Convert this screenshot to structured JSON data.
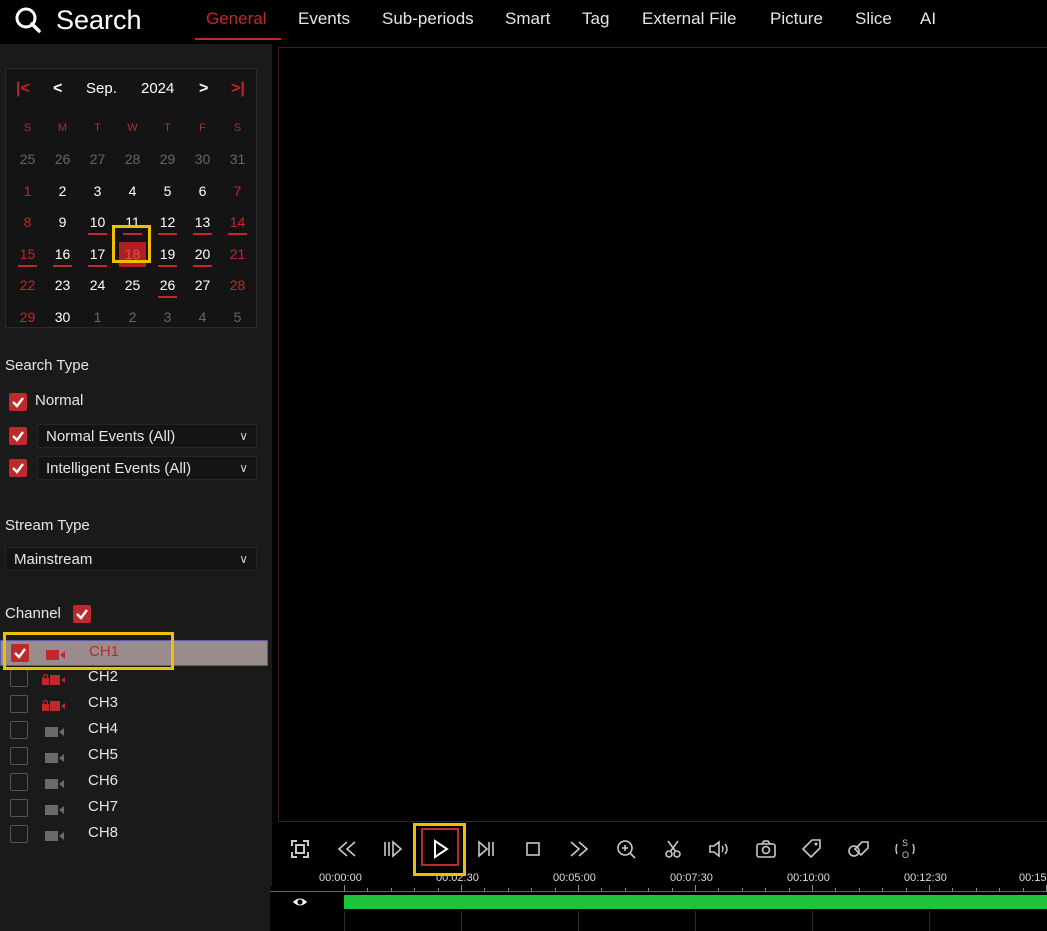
{
  "header": {
    "title": "Search",
    "tabs": [
      {
        "label": "General",
        "active": true
      },
      {
        "label": "Events"
      },
      {
        "label": "Sub-periods"
      },
      {
        "label": "Smart"
      },
      {
        "label": "Tag"
      },
      {
        "label": "External File"
      },
      {
        "label": "Picture"
      },
      {
        "label": "Slice"
      },
      {
        "label": "AI"
      }
    ]
  },
  "calendar": {
    "month": "Sep.",
    "year": "2024",
    "weekdays": [
      "S",
      "M",
      "T",
      "W",
      "T",
      "F",
      "S"
    ],
    "weeks": [
      [
        "25",
        "26",
        "27",
        "28",
        "29",
        "30",
        "31"
      ],
      [
        "1",
        "2",
        "3",
        "4",
        "5",
        "6",
        "7"
      ],
      [
        "8",
        "9",
        "10",
        "11",
        "12",
        "13",
        "14"
      ],
      [
        "15",
        "16",
        "17",
        "18",
        "19",
        "20",
        "21"
      ],
      [
        "22",
        "23",
        "24",
        "25",
        "26",
        "27",
        "28"
      ],
      [
        "29",
        "30",
        "1",
        "2",
        "3",
        "4",
        "5"
      ]
    ],
    "selected_day": "18",
    "days_with_recordings": [
      "10",
      "11",
      "12",
      "13",
      "14",
      "15",
      "16",
      "17",
      "19",
      "20",
      "26"
    ]
  },
  "search_type": {
    "label": "Search Type",
    "normal_label": "Normal",
    "normal_events": "Normal Events (All)",
    "intelligent_events": "Intelligent Events (All)"
  },
  "stream_type": {
    "label": "Stream Type",
    "value": "Mainstream"
  },
  "channel": {
    "label": "Channel",
    "items": [
      {
        "name": "CH1",
        "checked": true,
        "selected": true,
        "cam": "red"
      },
      {
        "name": "CH2",
        "checked": false,
        "cam": "red-lock"
      },
      {
        "name": "CH3",
        "checked": false,
        "cam": "red-lock"
      },
      {
        "name": "CH4",
        "checked": false,
        "cam": "gray"
      },
      {
        "name": "CH5",
        "checked": false,
        "cam": "gray"
      },
      {
        "name": "CH6",
        "checked": false,
        "cam": "gray"
      },
      {
        "name": "CH7",
        "checked": false,
        "cam": "gray"
      },
      {
        "name": "CH8",
        "checked": false,
        "cam": "gray"
      }
    ]
  },
  "controls": [
    "fullscreen-icon",
    "rewind-icon",
    "slow-forward-icon",
    "play-icon",
    "step-forward-icon",
    "stop-icon",
    "fast-forward-icon",
    "zoom-in-icon",
    "clip-icon",
    "volume-icon",
    "snapshot-icon",
    "tag-icon",
    "tag-manage-icon",
    "sync-icon"
  ],
  "timeline": {
    "labels": [
      "00:00:00",
      "00:02:30",
      "00:05:00",
      "00:07:30",
      "00:10:00",
      "00:12:30",
      "00:15"
    ],
    "recorded_fraction": 1.0,
    "colors": {
      "recorded": "#1fc43a",
      "accent": "#c0292b",
      "highlight": "#f0c000"
    }
  }
}
